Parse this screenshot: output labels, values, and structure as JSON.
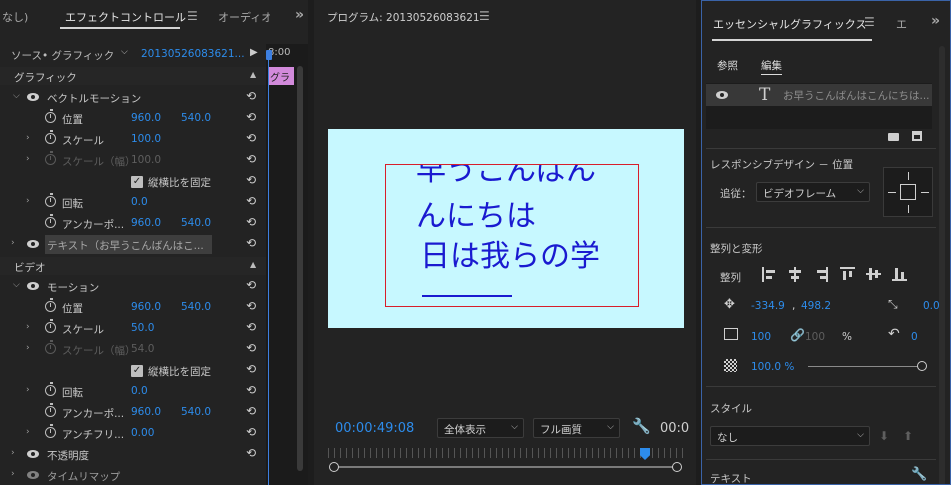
{
  "left_panel": {
    "tabs": [
      "なし)",
      "エフェクトコントロール",
      "オーディオ"
    ],
    "source_label": "ソース• グラフィック",
    "clip_name": "20130526083621...",
    "timecode_head": "8:00",
    "clip_bar_label": "グラ",
    "graphic_section": "グラフィック",
    "video_section": "ビデオ",
    "vector_motion": "ベクトルモーション",
    "position_label": "位置",
    "position_x": "960.0",
    "position_y": "540.0",
    "scale_label": "スケール",
    "scale_value": "100.0",
    "scale_width_label": "スケール（幅）",
    "scale_width_value": "100.0",
    "uniform_label": "縦横比を固定",
    "rotation_label": "回転",
    "rotation_value": "0.0",
    "anchor_label": "アンカーポ...",
    "anchor_x": "960.0",
    "anchor_y": "540.0",
    "text_layer": "テキスト（お早うこんばんはこ...",
    "motion_label": "モーション",
    "m_position_x": "960.0",
    "m_position_y": "540.0",
    "m_scale_value": "50.0",
    "m_scale_width_value": "54.0",
    "antiflicker_label": "アンチフリ...",
    "antiflicker_value": "0.00",
    "opacity_label": "不透明度",
    "time_remap_label": "タイムリマップ"
  },
  "program": {
    "title": "プログラム: 20130526083621",
    "canvas_text": [
      "早うこんばん",
      "んにちは",
      "日は我らの学"
    ],
    "canvas_top_text": "早うこんばん",
    "timecode": "00:00:49:08",
    "zoom": "全体表示",
    "quality": "フル画質",
    "timecode_end": "00:0"
  },
  "eg": {
    "tab": "エッセンシャルグラフィックス",
    "tab2": "エ",
    "browse": "参照",
    "edit": "編集",
    "layer_text": "お早うこんばんはこんにちは...",
    "responsive": "レスポンシブデザイン － 位置",
    "follow_label": "追従：",
    "follow_value": "ビデオフレーム",
    "align_section": "整列と変形",
    "align_label": "整列",
    "pos_x": "-334.9",
    "pos_sep": ",",
    "pos_y": "498.2",
    "anchor_x": "0.0",
    "scale_val": "100",
    "scale_val2": "100",
    "percent": "%",
    "rotation_val": "0",
    "opacity_val": "100.0 %",
    "style_section": "スタイル",
    "style_value": "なし",
    "text_section": "テキスト"
  },
  "colors": {
    "accent_blue": "#2d8ceb",
    "canvas_bg": "#c7f8ff",
    "canvas_text": "#1a1ad0",
    "clip_pink": "#d28adb",
    "guide_red": "#d81e2a"
  }
}
